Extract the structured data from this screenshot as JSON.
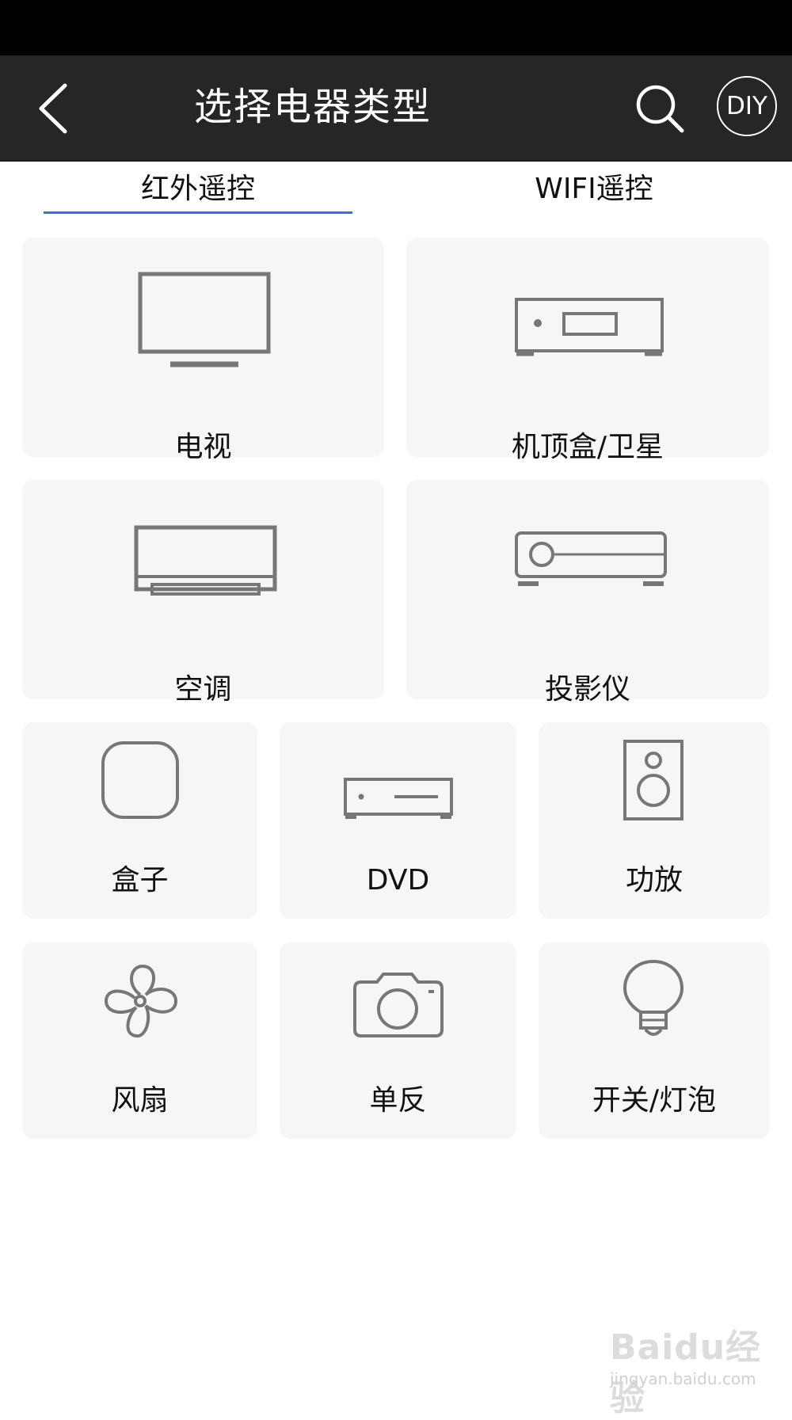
{
  "header": {
    "title": "选择电器类型",
    "diy_label": "DIY",
    "icons": [
      "back-arrow-icon",
      "search-icon"
    ]
  },
  "tabs": [
    {
      "label": "红外遥控",
      "active": true
    },
    {
      "label": "WIFI遥控",
      "active": false
    }
  ],
  "devices": [
    {
      "label": "电视",
      "icon": "tv-icon"
    },
    {
      "label": "机顶盒/卫星",
      "icon": "set-top-box-icon"
    },
    {
      "label": "空调",
      "icon": "air-conditioner-icon"
    },
    {
      "label": "投影仪",
      "icon": "projector-icon"
    },
    {
      "label": "盒子",
      "icon": "box-icon"
    },
    {
      "label": "DVD",
      "icon": "dvd-icon"
    },
    {
      "label": "功放",
      "icon": "speaker-icon"
    },
    {
      "label": "风扇",
      "icon": "fan-icon"
    },
    {
      "label": "单反",
      "icon": "camera-icon"
    },
    {
      "label": "开关/灯泡",
      "icon": "light-bulb-icon"
    }
  ],
  "colors": {
    "title_bar": "#262626",
    "tab_accent": "#3b6fd8",
    "card_bg": "#f6f6f6",
    "icon_stroke": "#777777"
  },
  "watermark": {
    "logo": "Baidu经验",
    "url": "jingyan.baidu.com"
  }
}
